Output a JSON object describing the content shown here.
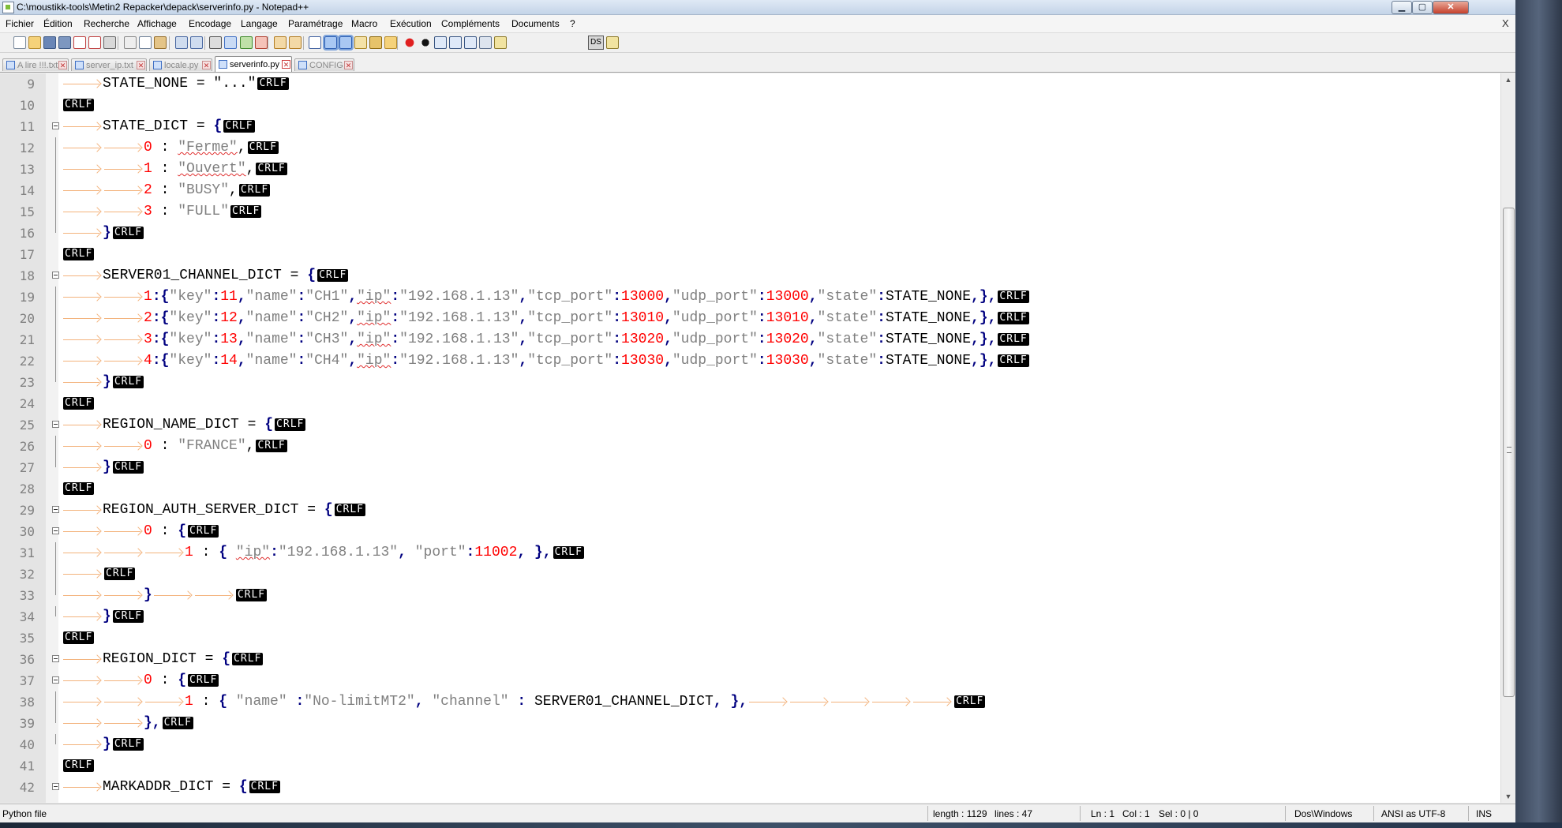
{
  "window": {
    "title": "C:\\moustikk-tools\\Metin2 Repacker\\depack\\serverinfo.py - Notepad++",
    "minimize_glyph": "▁",
    "maximize_glyph": "▢",
    "close_glyph": "✕"
  },
  "menu": {
    "items": [
      "Fichier",
      "Édition",
      "Recherche",
      "Affichage",
      "Encodage",
      "Langage",
      "Paramétrage",
      "Macro",
      "Exécution",
      "Compléments",
      "Documents",
      "?"
    ],
    "close_label": "X"
  },
  "toolbar": {
    "icons": [
      "new-file-icon",
      "open-file-icon",
      "save-icon",
      "save-all-icon",
      "close-icon",
      "close-all-icon",
      "print-icon",
      "cut-icon",
      "copy-icon",
      "paste-icon",
      "undo-icon",
      "redo-icon",
      "find-icon",
      "replace-icon",
      "zoom-in-icon",
      "zoom-out-icon",
      "sync-vertical-icon",
      "sync-horizontal-icon",
      "word-wrap-icon",
      "show-all-characters-icon",
      "indent-guide-icon",
      "user-language-icon",
      "function-list-icon",
      "folder-workspace-icon",
      "record-macro-icon",
      "stop-macro-icon",
      "play-macro-icon",
      "run-macro-multiple-icon",
      "save-macro-icon",
      "doc-switcher-icon",
      "spell-check-icon"
    ],
    "ds_label": "DS"
  },
  "tabs": [
    {
      "label": "A lire !!!.txt",
      "active": false
    },
    {
      "label": "server_ip.txt",
      "active": false
    },
    {
      "label": "locale.py",
      "active": false
    },
    {
      "label": "serverinfo.py",
      "active": true
    },
    {
      "label": "CONFIG",
      "active": false
    }
  ],
  "editor": {
    "eol_marker": "CRLF",
    "lines": [
      {
        "n": "9",
        "fold": "",
        "t": [
          [
            "tab"
          ],
          [
            "p",
            "STATE_NONE = \"...\""
          ],
          [
            "eol"
          ]
        ]
      },
      {
        "n": "10",
        "fold": "",
        "t": [
          [
            "eol"
          ]
        ]
      },
      {
        "n": "11",
        "fold": "box",
        "t": [
          [
            "tab"
          ],
          [
            "p",
            "STATE_DICT = "
          ],
          [
            "o",
            "{"
          ],
          [
            "eol"
          ]
        ]
      },
      {
        "n": "12",
        "fold": "line",
        "t": [
          [
            "tab"
          ],
          [
            "tab"
          ],
          [
            "n",
            "0"
          ],
          [
            "p",
            " : "
          ],
          [
            "s",
            "\"Ferme\""
          ],
          [
            "p",
            ","
          ],
          [
            "eol"
          ]
        ]
      },
      {
        "n": "13",
        "fold": "line",
        "t": [
          [
            "tab"
          ],
          [
            "tab"
          ],
          [
            "n",
            "1"
          ],
          [
            "p",
            " : "
          ],
          [
            "s",
            "\"Ouvert\""
          ],
          [
            "p",
            ","
          ],
          [
            "eol"
          ]
        ]
      },
      {
        "n": "14",
        "fold": "line",
        "t": [
          [
            "tab"
          ],
          [
            "tab"
          ],
          [
            "n",
            "2"
          ],
          [
            "p",
            " : "
          ],
          [
            "s",
            "\"BUSY\""
          ],
          [
            "p",
            ","
          ],
          [
            "eol"
          ]
        ]
      },
      {
        "n": "15",
        "fold": "line",
        "t": [
          [
            "tab"
          ],
          [
            "tab"
          ],
          [
            "n",
            "3"
          ],
          [
            "p",
            " : "
          ],
          [
            "s",
            "\"FULL\""
          ],
          [
            "eol"
          ]
        ]
      },
      {
        "n": "16",
        "fold": "end",
        "t": [
          [
            "tab"
          ],
          [
            "o",
            "}"
          ],
          [
            "eol"
          ]
        ]
      },
      {
        "n": "17",
        "fold": "",
        "t": [
          [
            "eol"
          ]
        ]
      },
      {
        "n": "18",
        "fold": "box",
        "t": [
          [
            "tab"
          ],
          [
            "p",
            "SERVER01_CHANNEL_DICT = "
          ],
          [
            "o",
            "{"
          ],
          [
            "eol"
          ]
        ]
      },
      {
        "n": "19",
        "fold": "line",
        "t": [
          [
            "tab"
          ],
          [
            "tab"
          ],
          [
            "n",
            "1"
          ],
          [
            "o",
            ":{"
          ],
          [
            "s",
            "\"key\""
          ],
          [
            "o",
            ":"
          ],
          [
            "n",
            "11"
          ],
          [
            "o",
            ","
          ],
          [
            "s",
            "\"name\""
          ],
          [
            "o",
            ":"
          ],
          [
            "s",
            "\"CH1\""
          ],
          [
            "o",
            ","
          ],
          [
            "s",
            "\"ip\""
          ],
          [
            "o",
            ":"
          ],
          [
            "s",
            "\"192.168.1.13\""
          ],
          [
            "o",
            ","
          ],
          [
            "s",
            "\"tcp_port\""
          ],
          [
            "o",
            ":"
          ],
          [
            "n",
            "13000"
          ],
          [
            "o",
            ","
          ],
          [
            "s",
            "\"udp_port\""
          ],
          [
            "o",
            ":"
          ],
          [
            "n",
            "13000"
          ],
          [
            "o",
            ","
          ],
          [
            "s",
            "\"state\""
          ],
          [
            "o",
            ":"
          ],
          [
            "p",
            "STATE_NONE"
          ],
          [
            "o",
            ",},"
          ],
          [
            "eol"
          ]
        ]
      },
      {
        "n": "20",
        "fold": "line",
        "t": [
          [
            "tab"
          ],
          [
            "tab"
          ],
          [
            "n",
            "2"
          ],
          [
            "o",
            ":{"
          ],
          [
            "s",
            "\"key\""
          ],
          [
            "o",
            ":"
          ],
          [
            "n",
            "12"
          ],
          [
            "o",
            ","
          ],
          [
            "s",
            "\"name\""
          ],
          [
            "o",
            ":"
          ],
          [
            "s",
            "\"CH2\""
          ],
          [
            "o",
            ","
          ],
          [
            "s",
            "\"ip\""
          ],
          [
            "o",
            ":"
          ],
          [
            "s",
            "\"192.168.1.13\""
          ],
          [
            "o",
            ","
          ],
          [
            "s",
            "\"tcp_port\""
          ],
          [
            "o",
            ":"
          ],
          [
            "n",
            "13010"
          ],
          [
            "o",
            ","
          ],
          [
            "s",
            "\"udp_port\""
          ],
          [
            "o",
            ":"
          ],
          [
            "n",
            "13010"
          ],
          [
            "o",
            ","
          ],
          [
            "s",
            "\"state\""
          ],
          [
            "o",
            ":"
          ],
          [
            "p",
            "STATE_NONE"
          ],
          [
            "o",
            ",},"
          ],
          [
            "eol"
          ]
        ]
      },
      {
        "n": "21",
        "fold": "line",
        "t": [
          [
            "tab"
          ],
          [
            "tab"
          ],
          [
            "n",
            "3"
          ],
          [
            "o",
            ":{"
          ],
          [
            "s",
            "\"key\""
          ],
          [
            "o",
            ":"
          ],
          [
            "n",
            "13"
          ],
          [
            "o",
            ","
          ],
          [
            "s",
            "\"name\""
          ],
          [
            "o",
            ":"
          ],
          [
            "s",
            "\"CH3\""
          ],
          [
            "o",
            ","
          ],
          [
            "s",
            "\"ip\""
          ],
          [
            "o",
            ":"
          ],
          [
            "s",
            "\"192.168.1.13\""
          ],
          [
            "o",
            ","
          ],
          [
            "s",
            "\"tcp_port\""
          ],
          [
            "o",
            ":"
          ],
          [
            "n",
            "13020"
          ],
          [
            "o",
            ","
          ],
          [
            "s",
            "\"udp_port\""
          ],
          [
            "o",
            ":"
          ],
          [
            "n",
            "13020"
          ],
          [
            "o",
            ","
          ],
          [
            "s",
            "\"state\""
          ],
          [
            "o",
            ":"
          ],
          [
            "p",
            "STATE_NONE"
          ],
          [
            "o",
            ",},"
          ],
          [
            "eol"
          ]
        ]
      },
      {
        "n": "22",
        "fold": "line",
        "t": [
          [
            "tab"
          ],
          [
            "tab"
          ],
          [
            "n",
            "4"
          ],
          [
            "o",
            ":{"
          ],
          [
            "s",
            "\"key\""
          ],
          [
            "o",
            ":"
          ],
          [
            "n",
            "14"
          ],
          [
            "o",
            ","
          ],
          [
            "s",
            "\"name\""
          ],
          [
            "o",
            ":"
          ],
          [
            "s",
            "\"CH4\""
          ],
          [
            "o",
            ","
          ],
          [
            "s",
            "\"ip\""
          ],
          [
            "o",
            ":"
          ],
          [
            "s",
            "\"192.168.1.13\""
          ],
          [
            "o",
            ","
          ],
          [
            "s",
            "\"tcp_port\""
          ],
          [
            "o",
            ":"
          ],
          [
            "n",
            "13030"
          ],
          [
            "o",
            ","
          ],
          [
            "s",
            "\"udp_port\""
          ],
          [
            "o",
            ":"
          ],
          [
            "n",
            "13030"
          ],
          [
            "o",
            ","
          ],
          [
            "s",
            "\"state\""
          ],
          [
            "o",
            ":"
          ],
          [
            "p",
            "STATE_NONE"
          ],
          [
            "o",
            ",},"
          ],
          [
            "eol"
          ]
        ]
      },
      {
        "n": "23",
        "fold": "end",
        "t": [
          [
            "tab"
          ],
          [
            "o",
            "}"
          ],
          [
            "eol"
          ]
        ]
      },
      {
        "n": "24",
        "fold": "",
        "t": [
          [
            "eol"
          ]
        ]
      },
      {
        "n": "25",
        "fold": "box",
        "t": [
          [
            "tab"
          ],
          [
            "p",
            "REGION_NAME_DICT = "
          ],
          [
            "o",
            "{"
          ],
          [
            "eol"
          ]
        ]
      },
      {
        "n": "26",
        "fold": "line",
        "t": [
          [
            "tab"
          ],
          [
            "tab"
          ],
          [
            "n",
            "0"
          ],
          [
            "p",
            " : "
          ],
          [
            "s",
            "\"FRANCE\""
          ],
          [
            "p",
            ","
          ],
          [
            "eol"
          ]
        ]
      },
      {
        "n": "27",
        "fold": "end",
        "t": [
          [
            "tab"
          ],
          [
            "o",
            "}"
          ],
          [
            "eol"
          ]
        ]
      },
      {
        "n": "28",
        "fold": "",
        "t": [
          [
            "eol"
          ]
        ]
      },
      {
        "n": "29",
        "fold": "box",
        "t": [
          [
            "tab"
          ],
          [
            "p",
            "REGION_AUTH_SERVER_DICT = "
          ],
          [
            "o",
            "{"
          ],
          [
            "eol"
          ]
        ]
      },
      {
        "n": "30",
        "fold": "box",
        "t": [
          [
            "tab"
          ],
          [
            "tab"
          ],
          [
            "n",
            "0"
          ],
          [
            "p",
            " : "
          ],
          [
            "o",
            "{"
          ],
          [
            "eol"
          ]
        ]
      },
      {
        "n": "31",
        "fold": "line",
        "t": [
          [
            "tab"
          ],
          [
            "tab"
          ],
          [
            "tab"
          ],
          [
            "n",
            "1"
          ],
          [
            "p",
            " : "
          ],
          [
            "o",
            "{"
          ],
          [
            "p",
            " "
          ],
          [
            "s",
            "\"ip\""
          ],
          [
            "o",
            ":"
          ],
          [
            "s",
            "\"192.168.1.13\""
          ],
          [
            "o",
            ","
          ],
          [
            "p",
            " "
          ],
          [
            "s",
            "\"port\""
          ],
          [
            "o",
            ":"
          ],
          [
            "n",
            "11002"
          ],
          [
            "o",
            ","
          ],
          [
            "p",
            " "
          ],
          [
            "o",
            "},"
          ],
          [
            "eol"
          ]
        ]
      },
      {
        "n": "32",
        "fold": "line",
        "t": [
          [
            "tab"
          ],
          [
            "eol"
          ]
        ]
      },
      {
        "n": "33",
        "fold": "end",
        "t": [
          [
            "tab"
          ],
          [
            "tab"
          ],
          [
            "o",
            "}"
          ],
          [
            "tab"
          ],
          [
            "tab"
          ],
          [
            "eol"
          ]
        ]
      },
      {
        "n": "34",
        "fold": "end",
        "t": [
          [
            "tab"
          ],
          [
            "o",
            "}"
          ],
          [
            "eol"
          ]
        ]
      },
      {
        "n": "35",
        "fold": "",
        "t": [
          [
            "eol"
          ]
        ]
      },
      {
        "n": "36",
        "fold": "box",
        "t": [
          [
            "tab"
          ],
          [
            "p",
            "REGION_DICT = "
          ],
          [
            "o",
            "{"
          ],
          [
            "eol"
          ]
        ]
      },
      {
        "n": "37",
        "fold": "box",
        "t": [
          [
            "tab"
          ],
          [
            "tab"
          ],
          [
            "n",
            "0"
          ],
          [
            "p",
            " : "
          ],
          [
            "o",
            "{"
          ],
          [
            "eol"
          ]
        ]
      },
      {
        "n": "38",
        "fold": "line",
        "t": [
          [
            "tab"
          ],
          [
            "tab"
          ],
          [
            "tab"
          ],
          [
            "n",
            "1"
          ],
          [
            "p",
            " : "
          ],
          [
            "o",
            "{"
          ],
          [
            "p",
            " "
          ],
          [
            "s",
            "\"name\""
          ],
          [
            "p",
            " "
          ],
          [
            "o",
            ":"
          ],
          [
            "s",
            "\"No-limitMT2\""
          ],
          [
            "o",
            ","
          ],
          [
            "p",
            " "
          ],
          [
            "s",
            "\"channel\""
          ],
          [
            "p",
            " "
          ],
          [
            "o",
            ":"
          ],
          [
            "p",
            " SERVER01_CHANNEL_DICT"
          ],
          [
            "o",
            ","
          ],
          [
            "p",
            " "
          ],
          [
            "o",
            "},"
          ],
          [
            "tab"
          ],
          [
            "tab"
          ],
          [
            "tab"
          ],
          [
            "tab"
          ],
          [
            "tab"
          ],
          [
            "eol"
          ]
        ]
      },
      {
        "n": "39",
        "fold": "end",
        "t": [
          [
            "tab"
          ],
          [
            "tab"
          ],
          [
            "o",
            "},"
          ],
          [
            "eol"
          ]
        ]
      },
      {
        "n": "40",
        "fold": "end",
        "t": [
          [
            "tab"
          ],
          [
            "o",
            "}"
          ],
          [
            "eol"
          ]
        ]
      },
      {
        "n": "41",
        "fold": "",
        "t": [
          [
            "eol"
          ]
        ]
      },
      {
        "n": "42",
        "fold": "box",
        "t": [
          [
            "tab"
          ],
          [
            "p",
            "MARKADDR_DICT = "
          ],
          [
            "o",
            "{"
          ],
          [
            "eol"
          ]
        ]
      }
    ],
    "spell_errors": [
      "Ferme",
      "Ouvert",
      "ip"
    ]
  },
  "status": {
    "file_type": "Python file",
    "length": "length : 1129",
    "lines": "lines : 47",
    "ln": "Ln : 1",
    "col": "Col : 1",
    "sel": "Sel : 0 | 0",
    "eol_format": "Dos\\Windows",
    "encoding": "ANSI as UTF-8",
    "mode": "INS"
  },
  "colors": {
    "string": "#808080",
    "number": "#ff0000",
    "operator": "#000080",
    "tab_arrow": "#f3b37d"
  }
}
